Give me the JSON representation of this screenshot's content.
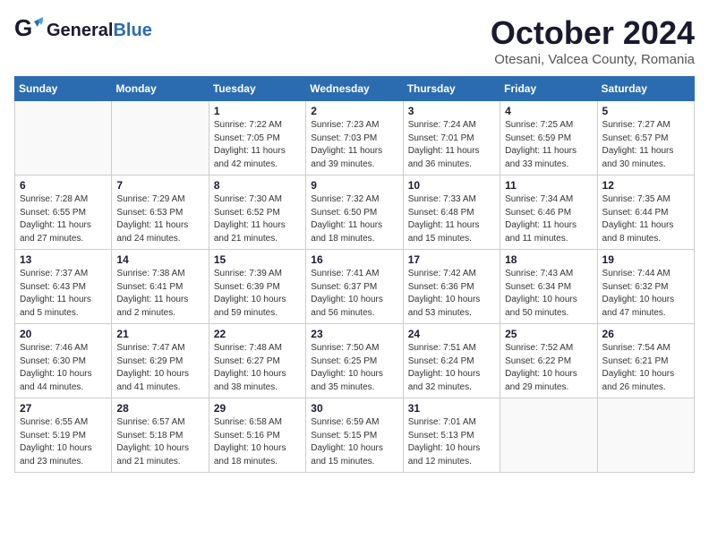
{
  "header": {
    "logo_general": "General",
    "logo_blue": "Blue",
    "month": "October 2024",
    "location": "Otesani, Valcea County, Romania"
  },
  "days_of_week": [
    "Sunday",
    "Monday",
    "Tuesday",
    "Wednesday",
    "Thursday",
    "Friday",
    "Saturday"
  ],
  "weeks": [
    [
      {
        "day": "",
        "info": ""
      },
      {
        "day": "",
        "info": ""
      },
      {
        "day": "1",
        "info": "Sunrise: 7:22 AM\nSunset: 7:05 PM\nDaylight: 11 hours and 42 minutes."
      },
      {
        "day": "2",
        "info": "Sunrise: 7:23 AM\nSunset: 7:03 PM\nDaylight: 11 hours and 39 minutes."
      },
      {
        "day": "3",
        "info": "Sunrise: 7:24 AM\nSunset: 7:01 PM\nDaylight: 11 hours and 36 minutes."
      },
      {
        "day": "4",
        "info": "Sunrise: 7:25 AM\nSunset: 6:59 PM\nDaylight: 11 hours and 33 minutes."
      },
      {
        "day": "5",
        "info": "Sunrise: 7:27 AM\nSunset: 6:57 PM\nDaylight: 11 hours and 30 minutes."
      }
    ],
    [
      {
        "day": "6",
        "info": "Sunrise: 7:28 AM\nSunset: 6:55 PM\nDaylight: 11 hours and 27 minutes."
      },
      {
        "day": "7",
        "info": "Sunrise: 7:29 AM\nSunset: 6:53 PM\nDaylight: 11 hours and 24 minutes."
      },
      {
        "day": "8",
        "info": "Sunrise: 7:30 AM\nSunset: 6:52 PM\nDaylight: 11 hours and 21 minutes."
      },
      {
        "day": "9",
        "info": "Sunrise: 7:32 AM\nSunset: 6:50 PM\nDaylight: 11 hours and 18 minutes."
      },
      {
        "day": "10",
        "info": "Sunrise: 7:33 AM\nSunset: 6:48 PM\nDaylight: 11 hours and 15 minutes."
      },
      {
        "day": "11",
        "info": "Sunrise: 7:34 AM\nSunset: 6:46 PM\nDaylight: 11 hours and 11 minutes."
      },
      {
        "day": "12",
        "info": "Sunrise: 7:35 AM\nSunset: 6:44 PM\nDaylight: 11 hours and 8 minutes."
      }
    ],
    [
      {
        "day": "13",
        "info": "Sunrise: 7:37 AM\nSunset: 6:43 PM\nDaylight: 11 hours and 5 minutes."
      },
      {
        "day": "14",
        "info": "Sunrise: 7:38 AM\nSunset: 6:41 PM\nDaylight: 11 hours and 2 minutes."
      },
      {
        "day": "15",
        "info": "Sunrise: 7:39 AM\nSunset: 6:39 PM\nDaylight: 10 hours and 59 minutes."
      },
      {
        "day": "16",
        "info": "Sunrise: 7:41 AM\nSunset: 6:37 PM\nDaylight: 10 hours and 56 minutes."
      },
      {
        "day": "17",
        "info": "Sunrise: 7:42 AM\nSunset: 6:36 PM\nDaylight: 10 hours and 53 minutes."
      },
      {
        "day": "18",
        "info": "Sunrise: 7:43 AM\nSunset: 6:34 PM\nDaylight: 10 hours and 50 minutes."
      },
      {
        "day": "19",
        "info": "Sunrise: 7:44 AM\nSunset: 6:32 PM\nDaylight: 10 hours and 47 minutes."
      }
    ],
    [
      {
        "day": "20",
        "info": "Sunrise: 7:46 AM\nSunset: 6:30 PM\nDaylight: 10 hours and 44 minutes."
      },
      {
        "day": "21",
        "info": "Sunrise: 7:47 AM\nSunset: 6:29 PM\nDaylight: 10 hours and 41 minutes."
      },
      {
        "day": "22",
        "info": "Sunrise: 7:48 AM\nSunset: 6:27 PM\nDaylight: 10 hours and 38 minutes."
      },
      {
        "day": "23",
        "info": "Sunrise: 7:50 AM\nSunset: 6:25 PM\nDaylight: 10 hours and 35 minutes."
      },
      {
        "day": "24",
        "info": "Sunrise: 7:51 AM\nSunset: 6:24 PM\nDaylight: 10 hours and 32 minutes."
      },
      {
        "day": "25",
        "info": "Sunrise: 7:52 AM\nSunset: 6:22 PM\nDaylight: 10 hours and 29 minutes."
      },
      {
        "day": "26",
        "info": "Sunrise: 7:54 AM\nSunset: 6:21 PM\nDaylight: 10 hours and 26 minutes."
      }
    ],
    [
      {
        "day": "27",
        "info": "Sunrise: 6:55 AM\nSunset: 5:19 PM\nDaylight: 10 hours and 23 minutes."
      },
      {
        "day": "28",
        "info": "Sunrise: 6:57 AM\nSunset: 5:18 PM\nDaylight: 10 hours and 21 minutes."
      },
      {
        "day": "29",
        "info": "Sunrise: 6:58 AM\nSunset: 5:16 PM\nDaylight: 10 hours and 18 minutes."
      },
      {
        "day": "30",
        "info": "Sunrise: 6:59 AM\nSunset: 5:15 PM\nDaylight: 10 hours and 15 minutes."
      },
      {
        "day": "31",
        "info": "Sunrise: 7:01 AM\nSunset: 5:13 PM\nDaylight: 10 hours and 12 minutes."
      },
      {
        "day": "",
        "info": ""
      },
      {
        "day": "",
        "info": ""
      }
    ]
  ]
}
